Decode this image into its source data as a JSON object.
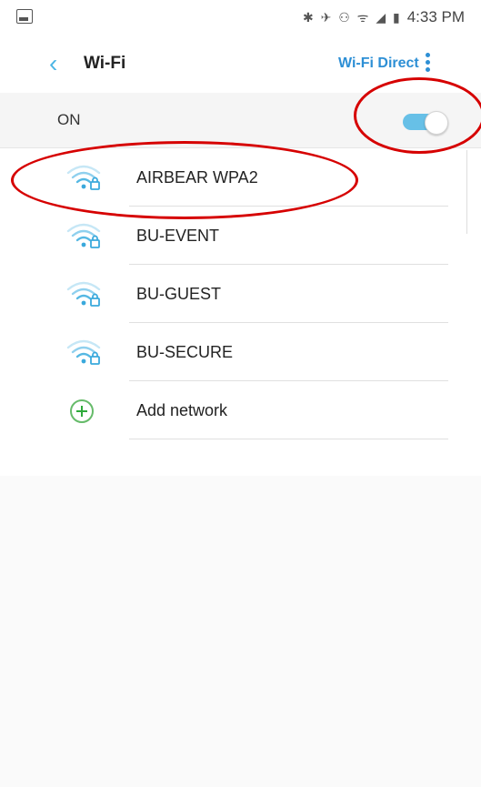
{
  "status_bar": {
    "time": "4:33 PM",
    "icons": "✱ ✈ ⚇ ᯤ ◢ ▮"
  },
  "app_bar": {
    "back_icon": "chevron-left-icon",
    "title": "Wi-Fi",
    "wifi_direct": "Wi-Fi Direct",
    "more_icon": "more-vertical-icon"
  },
  "wifi_toggle": {
    "label": "ON",
    "state": "on",
    "accent": "#67c0e7"
  },
  "networks": [
    {
      "ssid": "AIRBEAR WPA2",
      "icon": "wifi-locked-icon"
    },
    {
      "ssid": "BU-EVENT",
      "icon": "wifi-locked-icon"
    },
    {
      "ssid": "BU-GUEST",
      "icon": "wifi-locked-icon"
    },
    {
      "ssid": "BU-SECURE",
      "icon": "wifi-locked-icon"
    }
  ],
  "add_network": {
    "label": "Add network",
    "icon": "plus-circle-icon"
  },
  "annotation_color": "#d60000"
}
